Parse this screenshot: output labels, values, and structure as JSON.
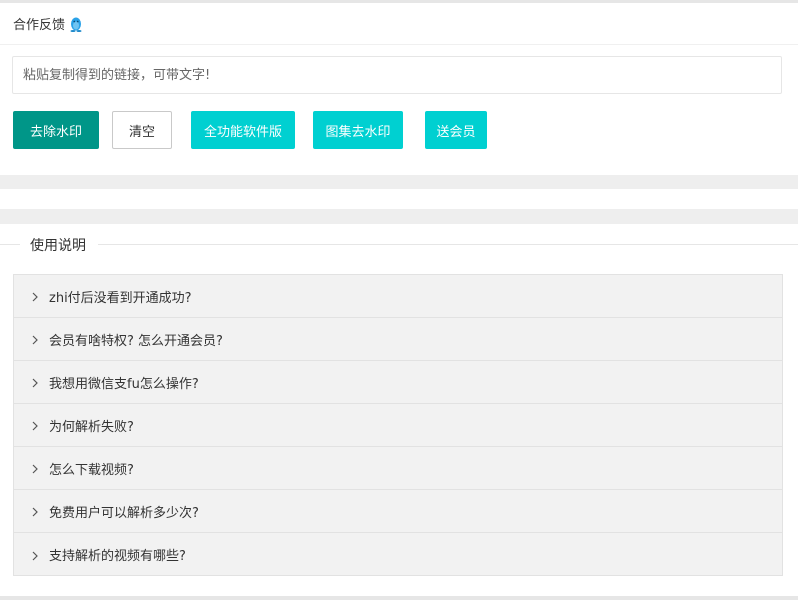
{
  "header": {
    "title": "合作反馈",
    "icon": "qq-penguin-icon"
  },
  "link_input": {
    "placeholder": "粘贴复制得到的链接，可带文字!",
    "value": ""
  },
  "buttons": {
    "remove_watermark": "去除水印",
    "clear": "清空",
    "full_software": "全功能软件版",
    "gallery_remove": "图集去水印",
    "gift_vip": "送会员"
  },
  "instructions": {
    "title": "使用说明",
    "items": [
      "zhi付后没看到开通成功?",
      "会员有啥特权? 怎么开通会员?",
      "我想用微信支fu怎么操作?",
      "为何解析失败?",
      "怎么下载视频?",
      "免费用户可以解析多少次?",
      "支持解析的视频有哪些?"
    ]
  },
  "colors": {
    "primary": "#009688",
    "cyan": "#00d0d1",
    "penguin": "#1e9fff"
  }
}
